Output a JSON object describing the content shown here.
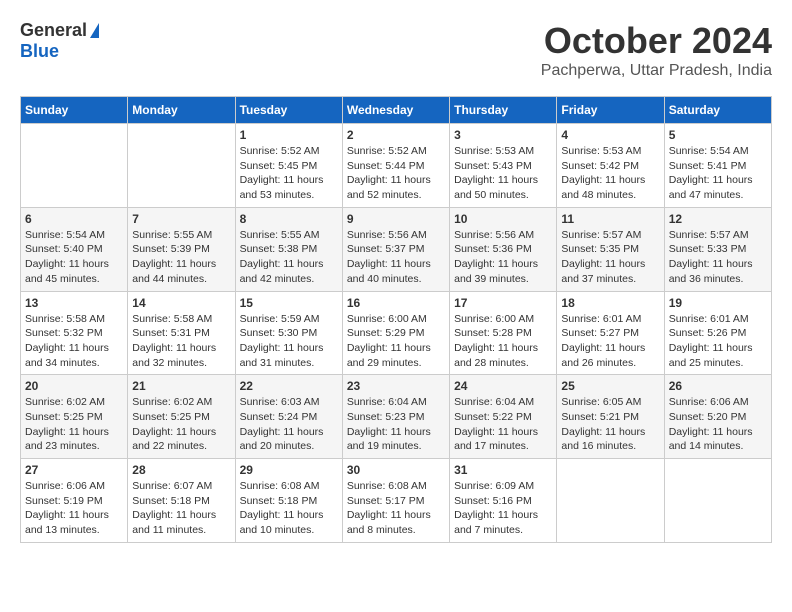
{
  "header": {
    "logo_general": "General",
    "logo_blue": "Blue",
    "month": "October 2024",
    "location": "Pachperwa, Uttar Pradesh, India"
  },
  "days_of_week": [
    "Sunday",
    "Monday",
    "Tuesday",
    "Wednesday",
    "Thursday",
    "Friday",
    "Saturday"
  ],
  "weeks": [
    [
      {
        "day": null
      },
      {
        "day": null
      },
      {
        "day": "1",
        "sunrise": "Sunrise: 5:52 AM",
        "sunset": "Sunset: 5:45 PM",
        "daylight": "Daylight: 11 hours and 53 minutes."
      },
      {
        "day": "2",
        "sunrise": "Sunrise: 5:52 AM",
        "sunset": "Sunset: 5:44 PM",
        "daylight": "Daylight: 11 hours and 52 minutes."
      },
      {
        "day": "3",
        "sunrise": "Sunrise: 5:53 AM",
        "sunset": "Sunset: 5:43 PM",
        "daylight": "Daylight: 11 hours and 50 minutes."
      },
      {
        "day": "4",
        "sunrise": "Sunrise: 5:53 AM",
        "sunset": "Sunset: 5:42 PM",
        "daylight": "Daylight: 11 hours and 48 minutes."
      },
      {
        "day": "5",
        "sunrise": "Sunrise: 5:54 AM",
        "sunset": "Sunset: 5:41 PM",
        "daylight": "Daylight: 11 hours and 47 minutes."
      }
    ],
    [
      {
        "day": "6",
        "sunrise": "Sunrise: 5:54 AM",
        "sunset": "Sunset: 5:40 PM",
        "daylight": "Daylight: 11 hours and 45 minutes."
      },
      {
        "day": "7",
        "sunrise": "Sunrise: 5:55 AM",
        "sunset": "Sunset: 5:39 PM",
        "daylight": "Daylight: 11 hours and 44 minutes."
      },
      {
        "day": "8",
        "sunrise": "Sunrise: 5:55 AM",
        "sunset": "Sunset: 5:38 PM",
        "daylight": "Daylight: 11 hours and 42 minutes."
      },
      {
        "day": "9",
        "sunrise": "Sunrise: 5:56 AM",
        "sunset": "Sunset: 5:37 PM",
        "daylight": "Daylight: 11 hours and 40 minutes."
      },
      {
        "day": "10",
        "sunrise": "Sunrise: 5:56 AM",
        "sunset": "Sunset: 5:36 PM",
        "daylight": "Daylight: 11 hours and 39 minutes."
      },
      {
        "day": "11",
        "sunrise": "Sunrise: 5:57 AM",
        "sunset": "Sunset: 5:35 PM",
        "daylight": "Daylight: 11 hours and 37 minutes."
      },
      {
        "day": "12",
        "sunrise": "Sunrise: 5:57 AM",
        "sunset": "Sunset: 5:33 PM",
        "daylight": "Daylight: 11 hours and 36 minutes."
      }
    ],
    [
      {
        "day": "13",
        "sunrise": "Sunrise: 5:58 AM",
        "sunset": "Sunset: 5:32 PM",
        "daylight": "Daylight: 11 hours and 34 minutes."
      },
      {
        "day": "14",
        "sunrise": "Sunrise: 5:58 AM",
        "sunset": "Sunset: 5:31 PM",
        "daylight": "Daylight: 11 hours and 32 minutes."
      },
      {
        "day": "15",
        "sunrise": "Sunrise: 5:59 AM",
        "sunset": "Sunset: 5:30 PM",
        "daylight": "Daylight: 11 hours and 31 minutes."
      },
      {
        "day": "16",
        "sunrise": "Sunrise: 6:00 AM",
        "sunset": "Sunset: 5:29 PM",
        "daylight": "Daylight: 11 hours and 29 minutes."
      },
      {
        "day": "17",
        "sunrise": "Sunrise: 6:00 AM",
        "sunset": "Sunset: 5:28 PM",
        "daylight": "Daylight: 11 hours and 28 minutes."
      },
      {
        "day": "18",
        "sunrise": "Sunrise: 6:01 AM",
        "sunset": "Sunset: 5:27 PM",
        "daylight": "Daylight: 11 hours and 26 minutes."
      },
      {
        "day": "19",
        "sunrise": "Sunrise: 6:01 AM",
        "sunset": "Sunset: 5:26 PM",
        "daylight": "Daylight: 11 hours and 25 minutes."
      }
    ],
    [
      {
        "day": "20",
        "sunrise": "Sunrise: 6:02 AM",
        "sunset": "Sunset: 5:25 PM",
        "daylight": "Daylight: 11 hours and 23 minutes."
      },
      {
        "day": "21",
        "sunrise": "Sunrise: 6:02 AM",
        "sunset": "Sunset: 5:25 PM",
        "daylight": "Daylight: 11 hours and 22 minutes."
      },
      {
        "day": "22",
        "sunrise": "Sunrise: 6:03 AM",
        "sunset": "Sunset: 5:24 PM",
        "daylight": "Daylight: 11 hours and 20 minutes."
      },
      {
        "day": "23",
        "sunrise": "Sunrise: 6:04 AM",
        "sunset": "Sunset: 5:23 PM",
        "daylight": "Daylight: 11 hours and 19 minutes."
      },
      {
        "day": "24",
        "sunrise": "Sunrise: 6:04 AM",
        "sunset": "Sunset: 5:22 PM",
        "daylight": "Daylight: 11 hours and 17 minutes."
      },
      {
        "day": "25",
        "sunrise": "Sunrise: 6:05 AM",
        "sunset": "Sunset: 5:21 PM",
        "daylight": "Daylight: 11 hours and 16 minutes."
      },
      {
        "day": "26",
        "sunrise": "Sunrise: 6:06 AM",
        "sunset": "Sunset: 5:20 PM",
        "daylight": "Daylight: 11 hours and 14 minutes."
      }
    ],
    [
      {
        "day": "27",
        "sunrise": "Sunrise: 6:06 AM",
        "sunset": "Sunset: 5:19 PM",
        "daylight": "Daylight: 11 hours and 13 minutes."
      },
      {
        "day": "28",
        "sunrise": "Sunrise: 6:07 AM",
        "sunset": "Sunset: 5:18 PM",
        "daylight": "Daylight: 11 hours and 11 minutes."
      },
      {
        "day": "29",
        "sunrise": "Sunrise: 6:08 AM",
        "sunset": "Sunset: 5:18 PM",
        "daylight": "Daylight: 11 hours and 10 minutes."
      },
      {
        "day": "30",
        "sunrise": "Sunrise: 6:08 AM",
        "sunset": "Sunset: 5:17 PM",
        "daylight": "Daylight: 11 hours and 8 minutes."
      },
      {
        "day": "31",
        "sunrise": "Sunrise: 6:09 AM",
        "sunset": "Sunset: 5:16 PM",
        "daylight": "Daylight: 11 hours and 7 minutes."
      },
      {
        "day": null
      },
      {
        "day": null
      }
    ]
  ]
}
